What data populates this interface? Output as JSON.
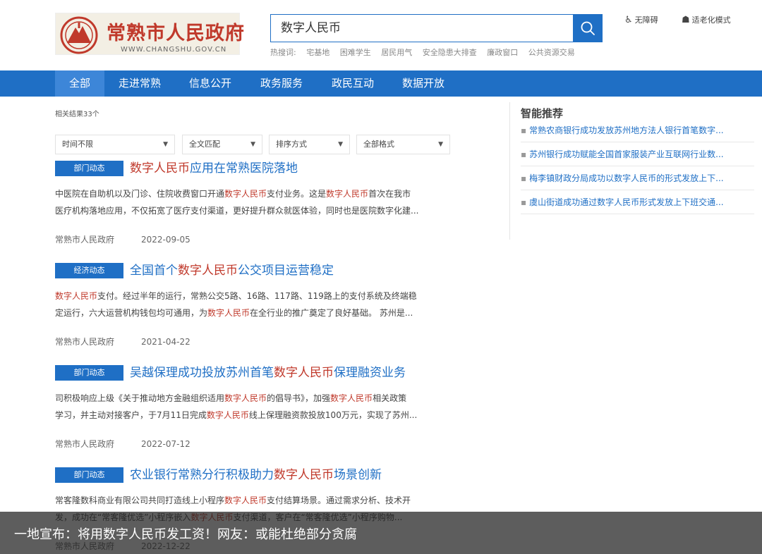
{
  "logo": {
    "title": "常熟市人民政府",
    "url": "WWW.CHANGSHU.GOV.CN"
  },
  "search": {
    "query": "数字人民币"
  },
  "hot": {
    "label": "热搜词:",
    "items": [
      "宅基地",
      "困难学生",
      "居民用气",
      "安全隐患大排查",
      "廉政窗口",
      "公共资源交易"
    ]
  },
  "top_links": {
    "accessibility": "无障碍",
    "elderly": "适老化模式"
  },
  "nav": [
    "全部",
    "走进常熟",
    "信息公开",
    "政务服务",
    "政民互动",
    "数据开放"
  ],
  "result_count": "相关结果33个",
  "filters": [
    "时间不限",
    "全文匹配",
    "排序方式",
    "全部格式"
  ],
  "results": [
    {
      "badge": "部门动态",
      "title_pre": "",
      "title_hl": "数字人民币",
      "title_post": "应用在常熟医院落地",
      "line1": [
        [
          "中医院在自助机以及门诊、住院收费窗口开通",
          ""
        ],
        [
          "数字人民币",
          "hl"
        ],
        [
          "支付业务。这是",
          ""
        ],
        [
          "数字人民币",
          "hl"
        ],
        [
          "首次在我市",
          ""
        ]
      ],
      "line2": [
        [
          "医疗机构落地应用，不仅拓宽了医疗支付渠道，更好提升群众就医体验，同时也是医院数字化建...",
          ""
        ]
      ],
      "source": "常熟市人民政府",
      "date": "2022-09-05"
    },
    {
      "badge": "经济动态",
      "title_pre": "全国首个",
      "title_hl": "数字人民币",
      "title_post": "公交项目运营稳定",
      "line1": [
        [
          "数字人民币",
          "hl"
        ],
        [
          "支付。经过半年的运行，常熟公交5路、16路、117路、119路上的支付系统及终端稳",
          ""
        ]
      ],
      "line2": [
        [
          "定运行，六大运营机构钱包均可通用，为",
          ""
        ],
        [
          "数字人民币",
          "hl"
        ],
        [
          "在全行业的推广奠定了良好基础。 苏州是...",
          ""
        ]
      ],
      "source": "常熟市人民政府",
      "date": "2021-04-22"
    },
    {
      "badge": "部门动态",
      "title_pre": "吴越保理成功投放苏州首笔",
      "title_hl": "数字人民币",
      "title_post": "保理融资业务",
      "line1": [
        [
          "司积极响应上级《关于推动地方金融组织适用",
          ""
        ],
        [
          "数字人民币",
          "hl"
        ],
        [
          "的倡导书》，加强",
          ""
        ],
        [
          "数字人民币",
          "hl"
        ],
        [
          "相关政策",
          ""
        ]
      ],
      "line2": [
        [
          "学习，并主动对接客户，于7月11日完成",
          ""
        ],
        [
          "数字人民币",
          "hl"
        ],
        [
          "线上保理融资款投放100万元，实现了苏州...",
          ""
        ]
      ],
      "source": "常熟市人民政府",
      "date": "2022-07-12"
    },
    {
      "badge": "部门动态",
      "title_pre": "农业银行常熟分行积极助力",
      "title_hl": "数字人民币",
      "title_post": "场景创新",
      "line1": [
        [
          "常客隆数科商业有限公司共同打造线上小程序",
          ""
        ],
        [
          "数字人民币",
          "hl"
        ],
        [
          "支付结算场景。通过需求分析、技术开",
          ""
        ]
      ],
      "line2": [
        [
          "发，成功在“常客隆优选”小程序嵌入",
          ""
        ],
        [
          "数字人民币",
          "hl"
        ],
        [
          "支付渠道，客户在“常客隆优选”小程序购物...",
          ""
        ]
      ],
      "source": "常熟市人民政府",
      "date": "2022-12-22"
    }
  ],
  "recommend": {
    "title": "智能推荐",
    "items": [
      "常熟农商银行成功发放苏州地方法人银行首笔数字...",
      "苏州银行成功赋能全国首家服装产业互联网行业数...",
      "梅李镇财政分局成功以数字人民币的形式发放上下...",
      "虞山街道成功通过数字人民币形式发放上下班交通..."
    ]
  },
  "overlay": {
    "caption": "一地宣布：将用数字人民币发工资！网友：或能杜绝部分贪腐"
  },
  "colors": {
    "primary": "#1f6fc5",
    "highlight": "#c0392b"
  }
}
